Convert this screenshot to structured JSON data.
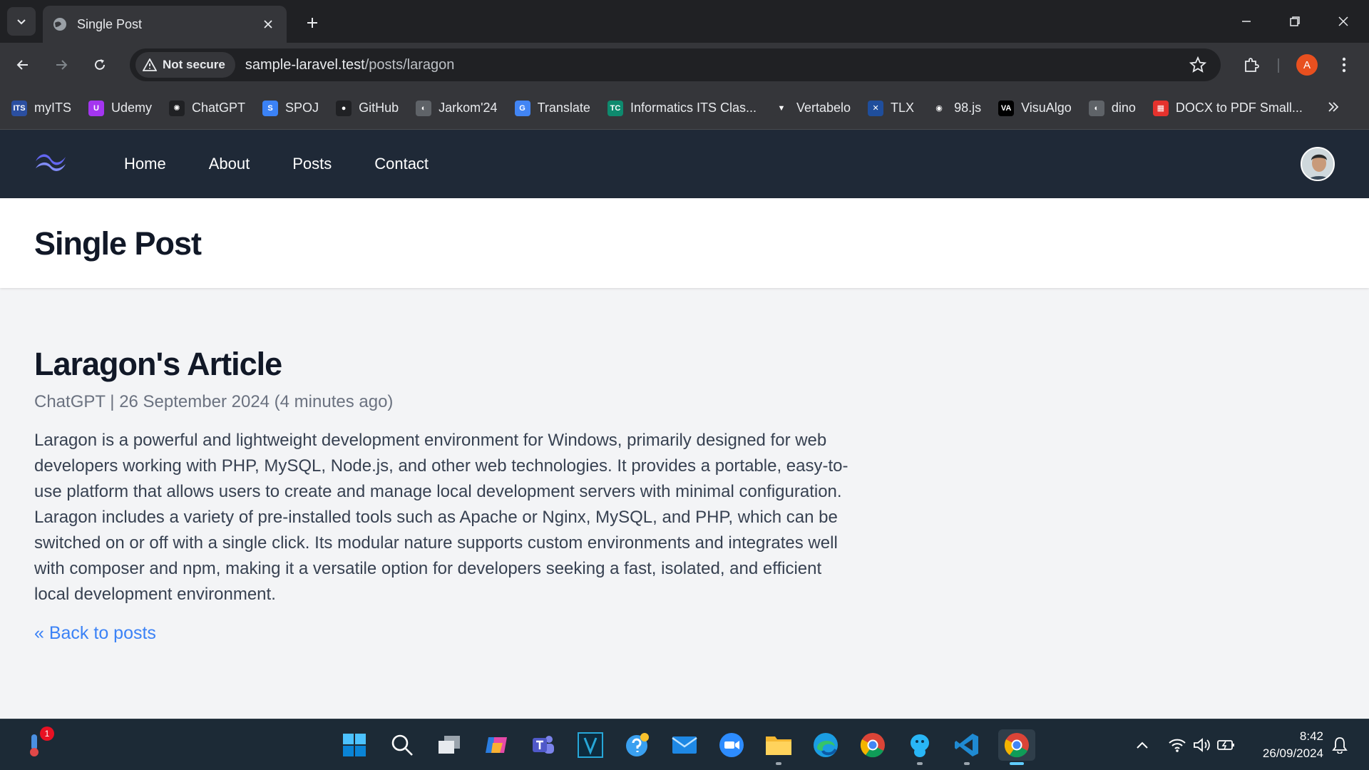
{
  "browser": {
    "tab_title": "Single Post",
    "security_label": "Not secure",
    "url_host": "sample-laravel.test",
    "url_path": "/posts/laragon",
    "profile_initial": "A",
    "bookmarks": [
      {
        "label": "myITS",
        "icon": "its-icon",
        "color": "#2b4fa0",
        "glyph": "ITS"
      },
      {
        "label": "Udemy",
        "icon": "udemy-icon",
        "color": "#a435f0",
        "glyph": "U"
      },
      {
        "label": "ChatGPT",
        "icon": "chatgpt-icon",
        "color": "#202124",
        "glyph": "✺"
      },
      {
        "label": "SPOJ",
        "icon": "spoj-icon",
        "color": "#3b82f6",
        "glyph": "S"
      },
      {
        "label": "GitHub",
        "icon": "github-icon",
        "color": "#202124",
        "glyph": "●"
      },
      {
        "label": "Jarkom'24",
        "icon": "globe-icon",
        "color": "#5f6368",
        "glyph": "◐"
      },
      {
        "label": "Translate",
        "icon": "translate-icon",
        "color": "#4285f4",
        "glyph": "G"
      },
      {
        "label": "Informatics ITS Clas...",
        "icon": "tc-icon",
        "color": "#0e8a6e",
        "glyph": "TC"
      },
      {
        "label": "Vertabelo",
        "icon": "vertabelo-icon",
        "color": "#35363a",
        "glyph": "▼"
      },
      {
        "label": "TLX",
        "icon": "tlx-icon",
        "color": "#1f4e9c",
        "glyph": "✕"
      },
      {
        "label": "98.js",
        "icon": "windows98-icon",
        "color": "#35363a",
        "glyph": "◉"
      },
      {
        "label": "VisuAlgo",
        "icon": "visualgo-icon",
        "color": "#000000",
        "glyph": "VA"
      },
      {
        "label": "dino",
        "icon": "globe-icon",
        "color": "#5f6368",
        "glyph": "◐"
      },
      {
        "label": "DOCX to PDF Small...",
        "icon": "smallpdf-icon",
        "color": "#e5322d",
        "glyph": "▦"
      }
    ]
  },
  "site": {
    "nav": [
      "Home",
      "About",
      "Posts",
      "Contact"
    ],
    "header_title": "Single Post"
  },
  "article": {
    "title": "Laragon's Article",
    "author": "ChatGPT",
    "separator": "|",
    "date": "26 September 2024 (4 minutes ago)",
    "body": "Laragon is a powerful and lightweight development environment for Windows, primarily designed for web developers working with PHP, MySQL, Node.js, and other web technologies. It provides a portable, easy-to-use platform that allows users to create and manage local development servers with minimal configuration. Laragon includes a variety of pre-installed tools such as Apache or Nginx, MySQL, and PHP, which can be switched on or off with a single click. Its modular nature supports custom environments and integrates well with composer and npm, making it a versatile option for developers seeking a fast, isolated, and efficient local development environment.",
    "back_link": "« Back to posts"
  },
  "taskbar": {
    "weather_badge": "1",
    "time": "8:42",
    "date": "26/09/2024"
  }
}
